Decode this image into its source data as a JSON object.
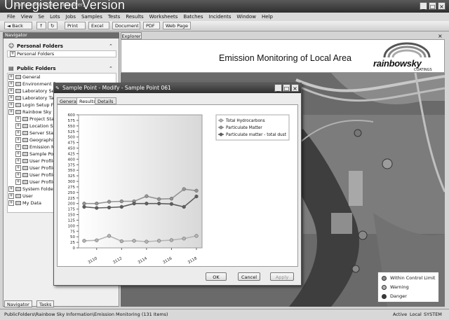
{
  "window": {
    "title": "Sample Manager - [Explorer]",
    "watermark": "Unregistered Version"
  },
  "menu": [
    "File",
    "View",
    "Se",
    "Lots",
    "Jobs",
    "Samples",
    "Tests",
    "Results",
    "Worksheets",
    "Batches",
    "Incidents",
    "Window",
    "Help"
  ],
  "toolbar": {
    "back": "Back",
    "print": "Print",
    "excel": "Excel",
    "document": "Document",
    "pdf": "PDF",
    "webpage": "Web Page"
  },
  "navigator": {
    "title": "Navigator",
    "personal_header": "Personal Folders",
    "personal_item": "Personal Folders",
    "public_header": "Public Folders",
    "items": [
      {
        "label": "General",
        "level": 0
      },
      {
        "label": "Environment F",
        "level": 0
      },
      {
        "label": "Laboratory Set",
        "level": 0
      },
      {
        "label": "Laboratory Tab",
        "level": 0
      },
      {
        "label": "Login Setup Fo",
        "level": 0
      },
      {
        "label": "Rainbow Sky I",
        "level": 0
      },
      {
        "label": "Project Sta",
        "level": 1
      },
      {
        "label": "Location S",
        "level": 1
      },
      {
        "label": "Server Stat",
        "level": 1
      },
      {
        "label": "Geographic",
        "level": 1
      },
      {
        "label": "Emission M",
        "level": 1
      },
      {
        "label": "Sample Poi",
        "level": 1
      },
      {
        "label": "User Profile",
        "level": 1
      },
      {
        "label": "User Profile",
        "level": 1
      },
      {
        "label": "User Profile",
        "level": 1
      },
      {
        "label": "User Profile",
        "level": 1
      },
      {
        "label": "System Folders",
        "level": 0
      },
      {
        "label": "User",
        "level": 0
      },
      {
        "label": "My Data",
        "level": 0
      }
    ],
    "tab_navigator": "Navigator",
    "tab_tasks": "Tasks"
  },
  "explorer": {
    "tab": "Explorer",
    "banner_title": "Emission Monitoring of Local Area",
    "logo_text": "rainbowsky",
    "logo_sub": "COATINGS"
  },
  "dialog": {
    "title": "Sample Point - Modify - Sample Point 061",
    "tabs": [
      "General",
      "Results",
      "Details"
    ],
    "ok": "OK",
    "cancel": "Cancel",
    "apply": "Apply"
  },
  "chart_data": {
    "type": "line",
    "x": [
      3109,
      3110,
      3111,
      3112,
      3113,
      3114,
      3115,
      3116,
      3117,
      3118
    ],
    "xticks": [
      3110,
      3112,
      3114,
      3116,
      3118
    ],
    "ylim": [
      0,
      600
    ],
    "yticks": [
      0,
      25,
      50,
      75,
      100,
      125,
      150,
      175,
      200,
      225,
      250,
      275,
      300,
      325,
      350,
      375,
      400,
      425,
      450,
      475,
      500,
      525,
      550,
      575,
      600
    ],
    "series": [
      {
        "name": "Total Hydrocarbons",
        "color": "#b4b4b4",
        "values": [
          32,
          34,
          54,
          30,
          32,
          28,
          32,
          35,
          42,
          54
        ]
      },
      {
        "name": "Particulate Matter",
        "color": "#949494",
        "values": [
          200,
          200,
          208,
          210,
          210,
          233,
          220,
          222,
          265,
          258
        ]
      },
      {
        "name": "Particulate matter - total dust",
        "color": "#5e5e5e",
        "values": [
          185,
          180,
          182,
          185,
          200,
          200,
          200,
          198,
          185,
          232
        ]
      }
    ]
  },
  "map_legend": [
    {
      "label": "Within Control Limit",
      "color": "#8a8a8a"
    },
    {
      "label": "Warning",
      "color": "#b0b0b0"
    },
    {
      "label": "Danger",
      "color": "#3a3a3a"
    }
  ],
  "status": {
    "path": "PublicFolders\\Rainbow Sky Information\\Emission Monitoring (131 Items)",
    "active": "Active",
    "local": "Local",
    "system": "SYSTEM"
  }
}
